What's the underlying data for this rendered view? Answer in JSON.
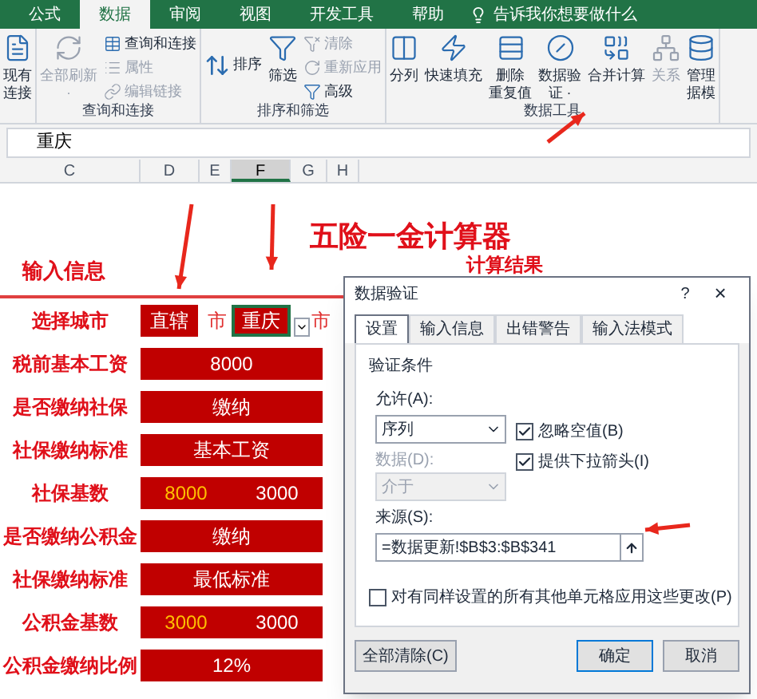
{
  "tabs": [
    {
      "label": "公式",
      "selected": false
    },
    {
      "label": "数据",
      "selected": true
    },
    {
      "label": "审阅",
      "selected": false
    },
    {
      "label": "视图",
      "selected": false
    },
    {
      "label": "开发工具",
      "selected": false
    },
    {
      "label": "帮助",
      "selected": false
    }
  ],
  "tell_me": "告诉我你想要做什么",
  "ribbon_groups": [
    {
      "items": [
        {
          "kind": "large",
          "lines": [
            "现有",
            "连接"
          ],
          "disabled": false
        }
      ]
    },
    {
      "label": "查询和连接",
      "items": [
        {
          "kind": "large",
          "lines": [
            "全部刷新",
            "·"
          ],
          "disabled": true
        },
        {
          "kind": "stack",
          "entries": [
            {
              "label": "查询和连接",
              "disabled": false
            },
            {
              "label": "属性",
              "disabled": true
            },
            {
              "label": "编辑链接",
              "disabled": true
            }
          ]
        }
      ]
    },
    {
      "label": "排序和筛选",
      "items": [
        {
          "kind": "sort",
          "label": "排序"
        },
        {
          "kind": "large",
          "lines": [
            "筛选"
          ],
          "disabled": false
        },
        {
          "kind": "stack",
          "entries": [
            {
              "label": "清除",
              "disabled": true
            },
            {
              "label": "重新应用",
              "disabled": true
            },
            {
              "label": "高级",
              "disabled": false
            }
          ]
        }
      ]
    },
    {
      "label": "数据工具",
      "items": [
        {
          "kind": "large",
          "lines": [
            "分列"
          ],
          "disabled": false
        },
        {
          "kind": "large",
          "lines": [
            "快速填充"
          ],
          "disabled": false
        },
        {
          "kind": "large",
          "lines": [
            "删除",
            "重复值"
          ],
          "disabled": false
        },
        {
          "kind": "large",
          "lines": [
            "数据验",
            "证 ·"
          ],
          "disabled": false
        },
        {
          "kind": "large",
          "lines": [
            "合并计算"
          ],
          "disabled": false
        },
        {
          "kind": "large",
          "lines": [
            "关系"
          ],
          "disabled": true
        },
        {
          "kind": "large",
          "lines": [
            "管理",
            "据模"
          ],
          "disabled": false
        }
      ]
    }
  ],
  "formula_bar": {
    "value": "重庆"
  },
  "columns": [
    {
      "label": "C",
      "selected": false
    },
    {
      "label": "D",
      "selected": false
    },
    {
      "label": "E",
      "selected": false
    },
    {
      "label": "F",
      "selected": true
    },
    {
      "label": "G",
      "selected": false
    },
    {
      "label": "H",
      "selected": false
    }
  ],
  "sheet": {
    "title": "五险一金计算器",
    "input_heading": "输入信息",
    "result_heading": "计算结果",
    "rows": [
      {
        "kind": "city",
        "label": "选择城市",
        "values": [
          "直辖",
          "市",
          "重庆",
          "市"
        ]
      },
      {
        "kind": "single",
        "label": "税前基本工资",
        "values": [
          "8000"
        ]
      },
      {
        "kind": "single",
        "label": "是否缴纳社保",
        "values": [
          "缴纳"
        ]
      },
      {
        "kind": "single",
        "label": "社保缴纳标准",
        "values": [
          "基本工资"
        ]
      },
      {
        "kind": "pair",
        "label": "社保基数",
        "values": [
          "8000",
          "3000"
        ]
      },
      {
        "kind": "single",
        "label": "是否缴纳公积金",
        "values": [
          "缴纳"
        ]
      },
      {
        "kind": "single",
        "label": "社保缴纳标准",
        "values": [
          "最低标准"
        ]
      },
      {
        "kind": "pair",
        "label": "公积金基数",
        "values": [
          "3000",
          "3000"
        ]
      },
      {
        "kind": "single",
        "label": "公积金缴纳比例",
        "values": [
          "12%"
        ]
      }
    ]
  },
  "dialog": {
    "title": "数据验证",
    "help": "?",
    "close": "×",
    "tabs": [
      {
        "label": "设置",
        "selected": true
      },
      {
        "label": "输入信息",
        "selected": false
      },
      {
        "label": "出错警告",
        "selected": false
      },
      {
        "label": "输入法模式",
        "selected": false
      }
    ],
    "section": "验证条件",
    "allow_label": "允许(A):",
    "allow_value": "序列",
    "data_label": "数据(D):",
    "data_value": "介于",
    "data_disabled": true,
    "options": [
      {
        "label": "忽略空值(B)",
        "checked": true
      },
      {
        "label": "提供下拉箭头(I)",
        "checked": true
      }
    ],
    "source_label": "来源(S):",
    "source_value": "=数据更新!$B$3:$B$341",
    "apply_all": {
      "label": "对有同样设置的所有其他单元格应用这些更改(P)",
      "checked": false
    },
    "clear_button": "全部清除(C)",
    "ok_button": "确定",
    "cancel_button": "取消"
  }
}
